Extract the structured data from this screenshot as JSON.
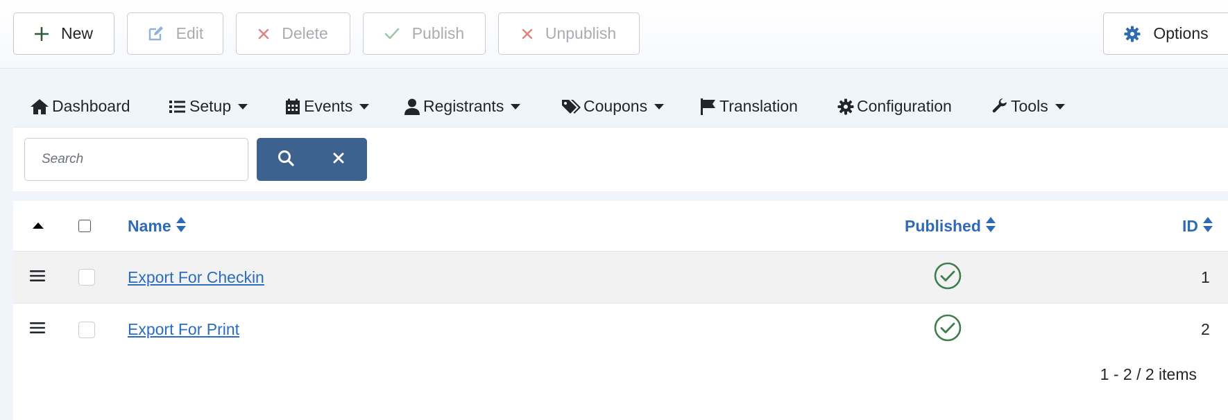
{
  "toolbar": {
    "new_label": "New",
    "edit_label": "Edit",
    "delete_label": "Delete",
    "publish_label": "Publish",
    "unpublish_label": "Unpublish",
    "options_label": "Options"
  },
  "menu": {
    "items": [
      {
        "label": "Dashboard",
        "icon": "home-icon",
        "dropdown": false
      },
      {
        "label": "Setup",
        "icon": "list-icon",
        "dropdown": true
      },
      {
        "label": "Events",
        "icon": "calendar-icon",
        "dropdown": true
      },
      {
        "label": "Registrants",
        "icon": "user-icon",
        "dropdown": true
      },
      {
        "label": "Coupons",
        "icon": "tags-icon",
        "dropdown": true
      },
      {
        "label": "Translation",
        "icon": "flag-icon",
        "dropdown": false
      },
      {
        "label": "Configuration",
        "icon": "gear-icon",
        "dropdown": false
      },
      {
        "label": "Tools",
        "icon": "wrench-icon",
        "dropdown": true
      }
    ]
  },
  "search": {
    "placeholder": "Search",
    "value": ""
  },
  "table": {
    "columns": {
      "name": "Name",
      "published": "Published",
      "id": "ID"
    },
    "rows": [
      {
        "name": "Export For Checkin",
        "published": true,
        "id": "1"
      },
      {
        "name": "Export For Print",
        "published": true,
        "id": "2"
      }
    ],
    "pagination": "1 - 2 / 2 items"
  },
  "colors": {
    "accent": "#2f6ab5",
    "search_button": "#3e6290",
    "published_check": "#3f7d4e",
    "delete_x": "#e08080"
  }
}
